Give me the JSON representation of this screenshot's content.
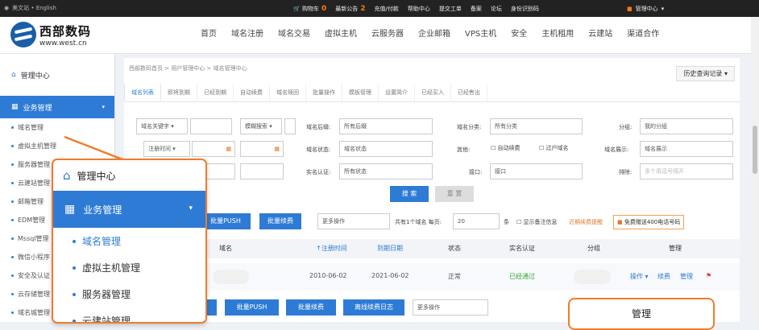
{
  "topbar": {
    "site_label": "美文站 • English",
    "cart_label": "购物车",
    "cart_count": "0",
    "notice_label": "最新公告",
    "notice_count": "2",
    "recharge": "充值/付款",
    "help": "帮助中心",
    "ticket": "提交工单",
    "beian": "备案",
    "forum": "论坛",
    "partner": "身份识别码",
    "user": "管理中心"
  },
  "logo": {
    "cn": "西部数码",
    "url": "www.west.cn"
  },
  "nav": [
    "首页",
    "域名注册",
    "域名交易",
    "虚拟主机",
    "云服务器",
    "企业邮箱",
    "VPS主机",
    "安全",
    "主机租用",
    "云建站",
    "渠道合作"
  ],
  "sidebar": {
    "head": "管理中心",
    "cat": "业务管理",
    "items": [
      "域名管理",
      "虚拟主机管理",
      "服务器管理",
      "云建站管理",
      "邮箱管理",
      "EDM管理",
      "Mssql管理",
      "微信小程序",
      "安全及认证",
      "云存储管理",
      "域名城管理"
    ]
  },
  "breadcrumb": "西部数码首页 > 用户管理中心 > 域名管理中心",
  "history": "历史查询记录 ▾",
  "tabs": [
    "域名列表",
    "即将到期",
    "已经到期",
    "自动续费",
    "域名赎回",
    "批量操作",
    "模板管理",
    "设置简介",
    "已经买入",
    "已经售出"
  ],
  "filters": {
    "kw_sel": "域名关键字 ▾",
    "fuzzy_sel": "模糊搜索 ▾",
    "suffix_label": "域名后缀:",
    "suffix_val": "所有后缀",
    "cat_label": "域名分类:",
    "cat_val": "所有分类",
    "group_label": "分组:",
    "group_val": "我的分组",
    "regtime_sel": "注册时间 ▾",
    "status_label": "域名状态:",
    "status_val": "域名状态",
    "other_label": "其他:",
    "auto_renew": "自动续费",
    "push": "过户域名",
    "display_label": "域名展示:",
    "display_val": "域名展示",
    "cert_label": "实名认证:",
    "cert_val": "所有状态",
    "iface_label": "接口:",
    "iface_val": "接口",
    "sort_label": "排除:",
    "sort_placeholder": "多个用逗号隔开"
  },
  "buttons": {
    "search": "搜 索",
    "reset": "重 置",
    "push": "批量PUSH",
    "renew": "批量续费",
    "more": "更多操作",
    "transfer": "离线续费日志"
  },
  "pager": {
    "total_text": "共有1个域名  每页:",
    "per_page": "20",
    "unit": "条",
    "showcert": "显示备注信息",
    "recent": "近期续费提醒",
    "promo": "免费赠送400电话号码"
  },
  "table": {
    "headers": [
      "域名",
      "↑注册时间",
      "到期日期",
      "状态",
      "实名认证",
      "分组",
      "管理"
    ],
    "row": {
      "reg": "2010-06-02",
      "exp": "2021-06-02",
      "status": "正常",
      "cert": "已经通过",
      "op": "操作 ▾",
      "renew": "续费",
      "manage": "管理"
    }
  },
  "popup_manage": "管理",
  "colors": {
    "accent": "#2e7bd6",
    "highlight": "#f07c2c"
  }
}
